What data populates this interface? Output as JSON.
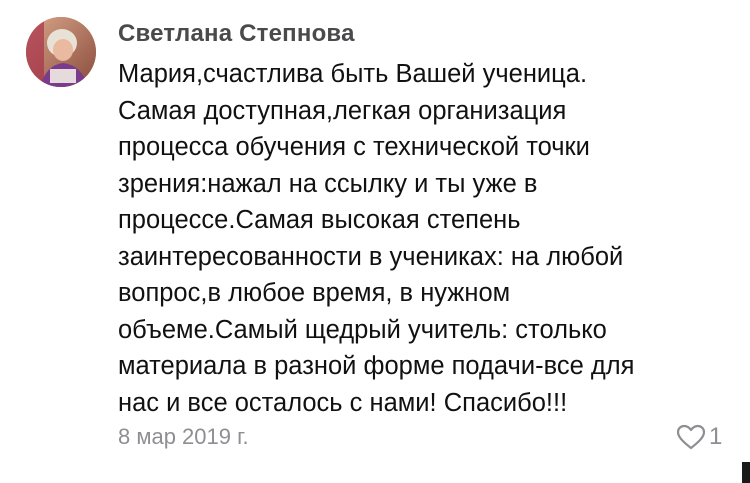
{
  "comment": {
    "author": "Светлана Степнова",
    "lines": [
      "Мария,счастлива быть Вашей ученица.",
      "Самая доступная,легкая организация",
      "процесса обучения с технической точки",
      "зрения:нажал на ссылку и ты уже в",
      "процессе.Самая высокая степень",
      "заинтересованности в учениках: на любой",
      "вопрос,в любое время, в нужном",
      "объеме.Самый щедрый учитель: столько",
      "материала в разной форме подачи-все для",
      "нас и все осталось с нами! Спасибо!!!"
    ],
    "date": "8 мар 2019 г.",
    "likes": "1",
    "like_icon": "heart-outline-icon"
  },
  "colors": {
    "author": "#4a4a4c",
    "text": "#111111",
    "meta": "#8e8e93"
  }
}
